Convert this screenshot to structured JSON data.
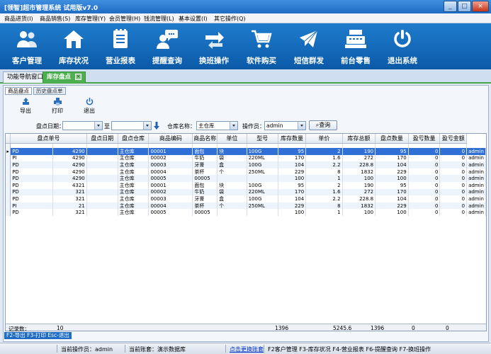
{
  "window": {
    "title": "[领智]超市管理系统 试用版v7.0",
    "minimize": "_",
    "maximize": "□",
    "close": "×"
  },
  "menu": [
    "商品进货(I)",
    "商品销售(S)",
    "库存管理(Y)",
    "会员管理(H)",
    "钱流管理(L)",
    "基本设置(I)",
    "其它操作(Q)"
  ],
  "toolbar": [
    {
      "label": "客户管理",
      "icon": "customer-icon"
    },
    {
      "label": "库存状况",
      "icon": "house-icon"
    },
    {
      "label": "营业报表",
      "icon": "report-icon"
    },
    {
      "label": "提醒查询",
      "icon": "chat-person-icon"
    },
    {
      "label": "换班操作",
      "icon": "exchange-icon"
    },
    {
      "label": "软件购买",
      "icon": "cart-icon"
    },
    {
      "label": "短信群发",
      "icon": "envelope-icon"
    },
    {
      "label": "前台零售",
      "icon": "cash-register-icon"
    },
    {
      "label": "退出系统",
      "icon": "power-icon"
    }
  ],
  "tabs": [
    {
      "label": "功能导航窗口",
      "active": false
    },
    {
      "label": "库存盘点",
      "active": true
    }
  ],
  "subtabs": [
    {
      "label": "商品盘点",
      "active": true
    },
    {
      "label": "历史盘点单",
      "active": false
    }
  ],
  "actions": [
    {
      "label": "导出",
      "icon": "export-icon"
    },
    {
      "label": "打印",
      "icon": "print-icon"
    },
    {
      "label": "退出",
      "icon": "exit-power-icon"
    }
  ],
  "filters": {
    "date_label": "盘点日期：",
    "date_from": "",
    "to_label": "至",
    "date_to": "",
    "warehouse_label": "仓库名称：",
    "warehouse_value": "主仓库",
    "operator_label": "操作员：",
    "operator_value": "admin",
    "search_label": "查询"
  },
  "grid": {
    "columns": [
      "盘点单号",
      "盘点日期",
      "盘点仓库",
      "商品编码",
      "商品名称",
      "单位",
      "型号",
      "库存数量",
      "单价",
      "库存总额",
      "盘点数量",
      "盈亏数量",
      "盈亏金额",
      "操作员"
    ],
    "rows": [
      [
        "PD",
        "4290",
        "",
        "主仓库",
        "00001",
        "面包",
        "块",
        "100G",
        "95",
        "2",
        "190",
        "95",
        "0",
        "0",
        "admin"
      ],
      [
        "PI",
        "4290",
        "",
        "主仓库",
        "00002",
        "牛奶",
        "袋",
        "220ML",
        "170",
        "1.6",
        "272",
        "170",
        "0",
        "0",
        "admin"
      ],
      [
        "PD",
        "4290",
        "",
        "主仓库",
        "00003",
        "牙膏",
        "盒",
        "100G",
        "104",
        "2.2",
        "228.8",
        "104",
        "0",
        "0",
        "admin"
      ],
      [
        "PD",
        "4290",
        "",
        "主仓库",
        "00004",
        "茶杯",
        "个",
        "250ML",
        "229",
        "8",
        "1832",
        "229",
        "0",
        "0",
        "admin"
      ],
      [
        "PD",
        "4290",
        "",
        "主仓库",
        "00005",
        "00005",
        "",
        "",
        "100",
        "1",
        "100",
        "100",
        "0",
        "0",
        "admin"
      ],
      [
        "PD",
        "4321",
        "",
        "主仓库",
        "00001",
        "面包",
        "块",
        "100G",
        "95",
        "2",
        "190",
        "95",
        "0",
        "0",
        "admin"
      ],
      [
        "PD",
        "321",
        "",
        "主仓库",
        "00002",
        "牛奶",
        "袋",
        "220ML",
        "170",
        "1.6",
        "272",
        "170",
        "0",
        "0",
        "admin"
      ],
      [
        "PD",
        "321",
        "",
        "主仓库",
        "00003",
        "牙膏",
        "盒",
        "100G",
        "104",
        "2.2",
        "228.8",
        "104",
        "0",
        "0",
        "admin"
      ],
      [
        "PI",
        "21",
        "",
        "主仓库",
        "00004",
        "茶杯",
        "个",
        "250ML",
        "229",
        "8",
        "1832",
        "229",
        "0",
        "0",
        "admin"
      ],
      [
        "PD",
        "321",
        "",
        "主仓库",
        "00005",
        "00005",
        "",
        "",
        "100",
        "1",
        "100",
        "100",
        "0",
        "0",
        "admin"
      ]
    ],
    "summary": {
      "label": "记录数：",
      "count": "10",
      "stock_qty": "1396",
      "stock_total": "5245.6",
      "check_qty": "1396",
      "diff_qty": "0",
      "diff_amount": "0"
    }
  },
  "hotkeys": "F2-导出 F3-打印 Esc-退出",
  "status": {
    "operator": "当前操作员：admin",
    "account": "当前账套：演示数据库",
    "switch_link": "点击更换账套",
    "shortcuts": "F2客户管理 F3-库存状况 F4-营业报表 F6-提醒查询 F7-换班操作"
  },
  "colors": {
    "toolbar_bg": "#0b5aa8",
    "active_tab": "#4caf50",
    "selected_row": "#2f6fd6"
  }
}
